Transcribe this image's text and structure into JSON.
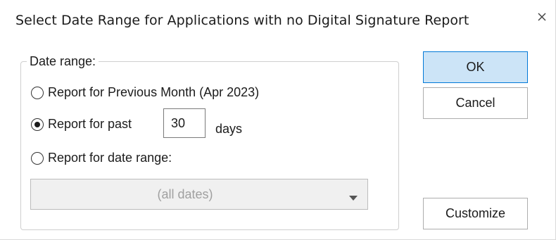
{
  "dialog": {
    "title": "Select Date Range for Applications with no Digital Signature Report",
    "close_icon": "close-icon"
  },
  "date_range": {
    "legend": "Date range:",
    "options": [
      {
        "label": "Report for Previous Month (Apr 2023)",
        "selected": false
      },
      {
        "label": "Report for past",
        "selected": true
      },
      {
        "label": "Report for date range:",
        "selected": false
      }
    ],
    "days_value": "30",
    "days_suffix": "days",
    "range_select": {
      "value": "(all dates)",
      "icon": "dropdown-arrow-icon"
    }
  },
  "buttons": {
    "ok": "OK",
    "cancel": "Cancel",
    "customize": "Customize"
  },
  "colors": {
    "default_button_fill": "#cce4f7",
    "default_button_border": "#0078d7",
    "disabled_text": "#a0a0a0"
  }
}
